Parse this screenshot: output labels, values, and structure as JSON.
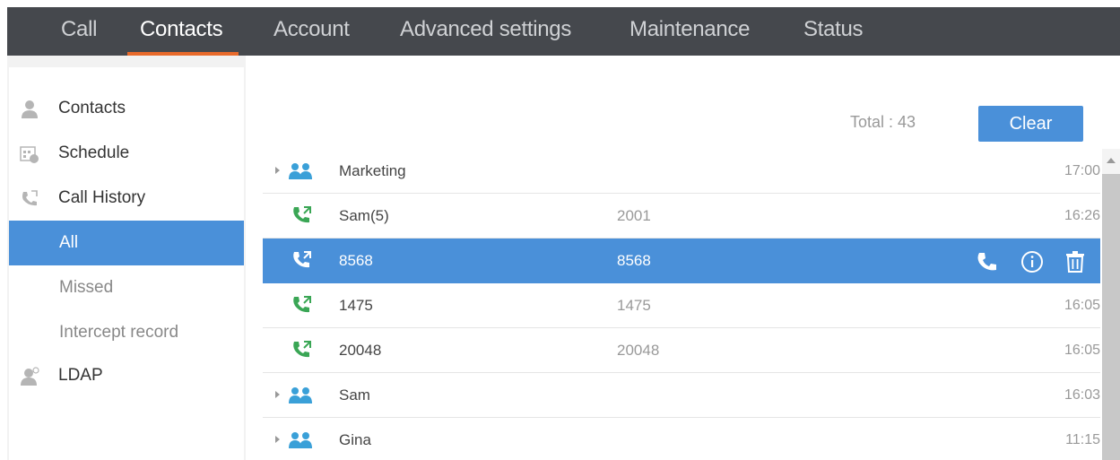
{
  "nav": {
    "tabs": [
      "Call",
      "Contacts",
      "Account",
      "Advanced settings",
      "Maintenance",
      "Status"
    ],
    "active": "Contacts"
  },
  "sidebar": {
    "items": [
      {
        "label": "Contacts",
        "icon": "person-icon"
      },
      {
        "label": "Schedule",
        "icon": "calendar-icon"
      },
      {
        "label": "Call History",
        "icon": "call-history-icon"
      },
      {
        "label": "All"
      },
      {
        "label": "Missed"
      },
      {
        "label": "Intercept record"
      },
      {
        "label": "LDAP",
        "icon": "ldap-icon"
      }
    ]
  },
  "main": {
    "total": "Total : 43",
    "clear_label": "Clear",
    "rows": [
      {
        "type": "group",
        "name": "Marketing",
        "number": "",
        "time": "17:00"
      },
      {
        "type": "call",
        "name": "Sam(5)",
        "number": "2001",
        "time": "16:26"
      },
      {
        "type": "call",
        "name": "8568",
        "number": "8568",
        "time": ""
      },
      {
        "type": "call",
        "name": "1475",
        "number": "1475",
        "time": "16:05"
      },
      {
        "type": "call",
        "name": "20048",
        "number": "20048",
        "time": "16:05"
      },
      {
        "type": "group",
        "name": "Sam",
        "number": "",
        "time": "16:03"
      },
      {
        "type": "group",
        "name": "Gina",
        "number": "",
        "time": "11:15"
      }
    ]
  },
  "colors": {
    "accent": "#4a90d9",
    "nav_bg": "#45484d",
    "tab_underline": "#e86a2b",
    "call_green": "#3aa655",
    "group_blue": "#3aa0d8"
  }
}
